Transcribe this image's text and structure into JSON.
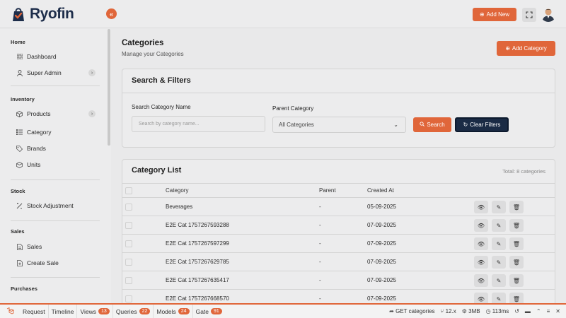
{
  "brand": {
    "name": "Ryofin"
  },
  "header": {
    "add_new": "Add New"
  },
  "sidebar": {
    "sections": [
      {
        "title": "Home",
        "items": [
          {
            "label": "Dashboard",
            "icon": "grid-icon"
          },
          {
            "label": "Super Admin",
            "icon": "user-icon",
            "expandable": true
          }
        ]
      },
      {
        "title": "Inventory",
        "items": [
          {
            "label": "Products",
            "icon": "box-icon",
            "expandable": true
          },
          {
            "label": "Category",
            "icon": "category-icon"
          },
          {
            "label": "Brands",
            "icon": "tag-icon"
          },
          {
            "label": "Units",
            "icon": "cube-icon"
          }
        ]
      },
      {
        "title": "Stock",
        "items": [
          {
            "label": "Stock Adjustment",
            "icon": "adjust-icon"
          }
        ]
      },
      {
        "title": "Sales",
        "items": [
          {
            "label": "Sales",
            "icon": "document-icon"
          },
          {
            "label": "Create Sale",
            "icon": "document-plus-icon"
          }
        ]
      },
      {
        "title": "Purchases",
        "items": []
      }
    ]
  },
  "page": {
    "title": "Categories",
    "subtitle": "Manage your Categories",
    "add_button": "Add Category"
  },
  "filters": {
    "title": "Search & Filters",
    "name_label": "Search Category Name",
    "name_placeholder": "Search by category name...",
    "parent_label": "Parent Category",
    "parent_value": "All Categories",
    "search_button": "Search",
    "clear_button": "Clear Filters"
  },
  "list": {
    "title": "Category List",
    "total": "Total: 8 categories",
    "columns": [
      "Category",
      "Parent",
      "Created At"
    ],
    "rows": [
      {
        "category": "Beverages",
        "parent": "-",
        "created": "05-09-2025"
      },
      {
        "category": "E2E Cat 1757267593288",
        "parent": "-",
        "created": "07-09-2025"
      },
      {
        "category": "E2E Cat 1757267597299",
        "parent": "-",
        "created": "07-09-2025"
      },
      {
        "category": "E2E Cat 1757267629785",
        "parent": "-",
        "created": "07-09-2025"
      },
      {
        "category": "E2E Cat 1757267635417",
        "parent": "-",
        "created": "07-09-2025"
      },
      {
        "category": "E2E Cat 1757267668570",
        "parent": "-",
        "created": "07-09-2025"
      }
    ]
  },
  "debugbar": {
    "tabs": [
      {
        "label": "Request"
      },
      {
        "label": "Timeline"
      },
      {
        "label": "Views",
        "badge": "13"
      },
      {
        "label": "Queries",
        "badge": "22"
      },
      {
        "label": "Models",
        "badge": "24"
      },
      {
        "label": "Gate",
        "badge": "91"
      }
    ],
    "route": "GET categories",
    "version": "12.x",
    "memory": "3MB",
    "time": "113ms"
  },
  "colors": {
    "accent": "#e0663a",
    "navy": "#1a2b45"
  }
}
